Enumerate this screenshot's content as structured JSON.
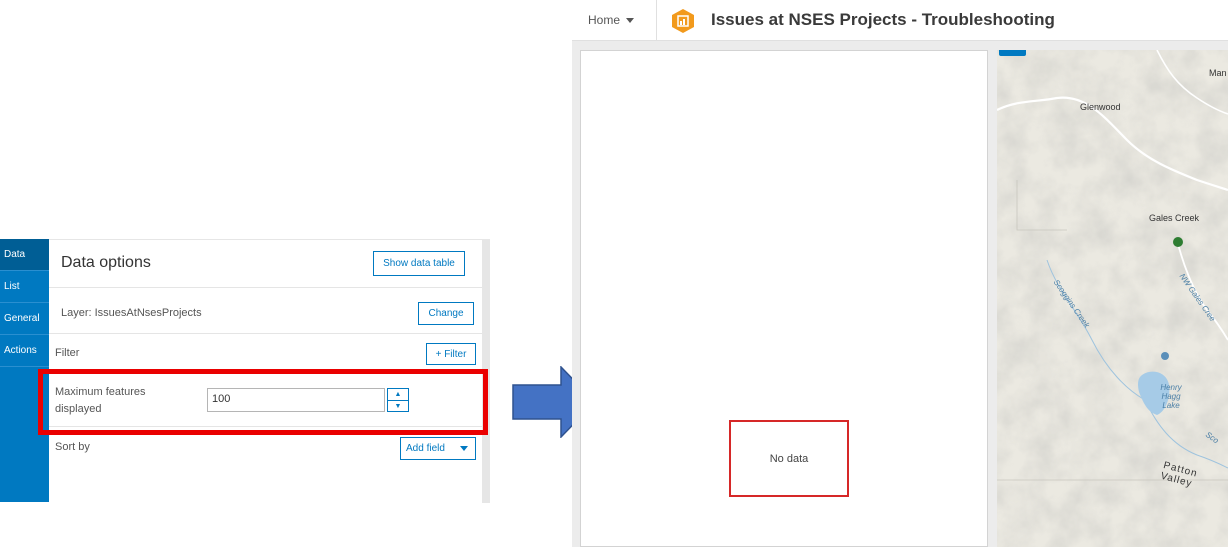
{
  "settings": {
    "tabs": [
      {
        "label": "Data"
      },
      {
        "label": "List"
      },
      {
        "label": "General"
      },
      {
        "label": "Actions"
      }
    ],
    "title": "Data options",
    "show_table_label": "Show data table",
    "layer_label": "Layer: IssuesAtNsesProjects",
    "change_label": "Change",
    "filter_label": "Filter",
    "add_filter_label": "+ Filter",
    "max_features_label": "Maximum features displayed",
    "max_features_value": "100",
    "sort_label": "Sort by",
    "add_field_label": "Add field"
  },
  "dashboard": {
    "home_label": "Home",
    "title": "Issues at NSES Projects - Troubleshooting",
    "no_data": "No data",
    "map_labels": {
      "glenwood": "Glenwood",
      "man": "Man",
      "gales_creek": "Gales Creek",
      "nw_gales_creek": "NW Gales Cree",
      "scoggins_creek": "Scoggins Creek",
      "henry_hagg_lake": "Henry Hagg Lake",
      "patton_valley": "Patton Valley",
      "sco": "Sco"
    }
  },
  "colors": {
    "accent": "#0079c1",
    "highlight": "#ea0000",
    "arrow": "#4472c4",
    "logo": "#f29a1c",
    "point_green": "#2e7d32",
    "point_blue": "#5b8fb9"
  }
}
